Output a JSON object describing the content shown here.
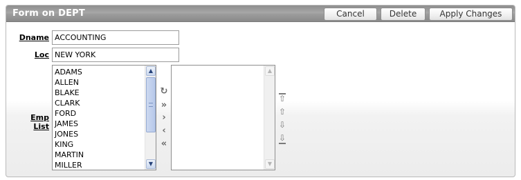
{
  "region": {
    "title": "Form on DEPT",
    "buttons": {
      "cancel": "Cancel",
      "delete": "Delete",
      "apply": "Apply Changes"
    }
  },
  "form": {
    "dname": {
      "label": "Dname",
      "value": "ACCOUNTING"
    },
    "loc": {
      "label": "Loc",
      "value": "NEW YORK"
    },
    "emp_list": {
      "label": "Emp List",
      "available": [
        "ADAMS",
        "ALLEN",
        "BLAKE",
        "CLARK",
        "FORD",
        "JAMES",
        "JONES",
        "KING",
        "MARTIN",
        "MILLER"
      ],
      "selected": []
    }
  },
  "icons": {
    "shuttle": [
      "reset-icon",
      "move-all-icon",
      "move-icon",
      "remove-icon",
      "remove-all-icon"
    ],
    "order": [
      "move-top-icon",
      "move-up-icon",
      "move-down-icon",
      "move-bottom-icon"
    ]
  },
  "colors": {
    "header_bg": "#9c9c9c",
    "header_text": "#ffffff",
    "scrollbar_accent": "#c9d7ee"
  }
}
